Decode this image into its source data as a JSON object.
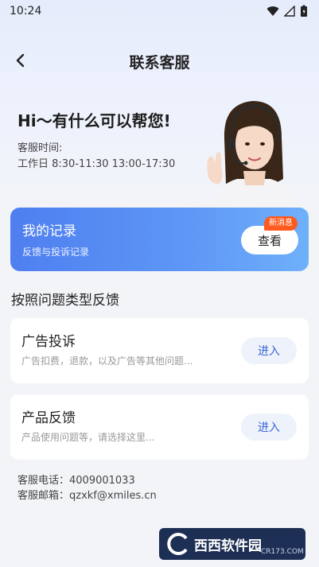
{
  "status_bar": {
    "time": "10:24"
  },
  "nav": {
    "title": "联系客服"
  },
  "hero": {
    "greeting": "Hi～有什么可以帮您!",
    "hours_label": "客服时间:",
    "hours_value": "工作日 8:30-11:30 13:00-17:30"
  },
  "records": {
    "title": "我的记录",
    "subtitle": "反馈与投诉记录",
    "view_label": "查看",
    "badge": "新消息"
  },
  "section": {
    "heading": "按照问题类型反馈"
  },
  "categories": [
    {
      "title": "广告投诉",
      "desc": "广告扣费，退款，以及广告等其他问题...",
      "button": "进入"
    },
    {
      "title": "产品反馈",
      "desc": "产品使用问题等，请选择这里...",
      "button": "进入"
    }
  ],
  "contact": {
    "phone": "客服电话：4009001033",
    "email": "客服邮箱：qzxkf@xmiles.cn"
  },
  "watermark": {
    "text": "西西软件园",
    "sub": "CR173.COM"
  },
  "colors": {
    "accent": "#4f7ff0",
    "badge": "#ff5a1f",
    "enter_text": "#3b68d8"
  }
}
